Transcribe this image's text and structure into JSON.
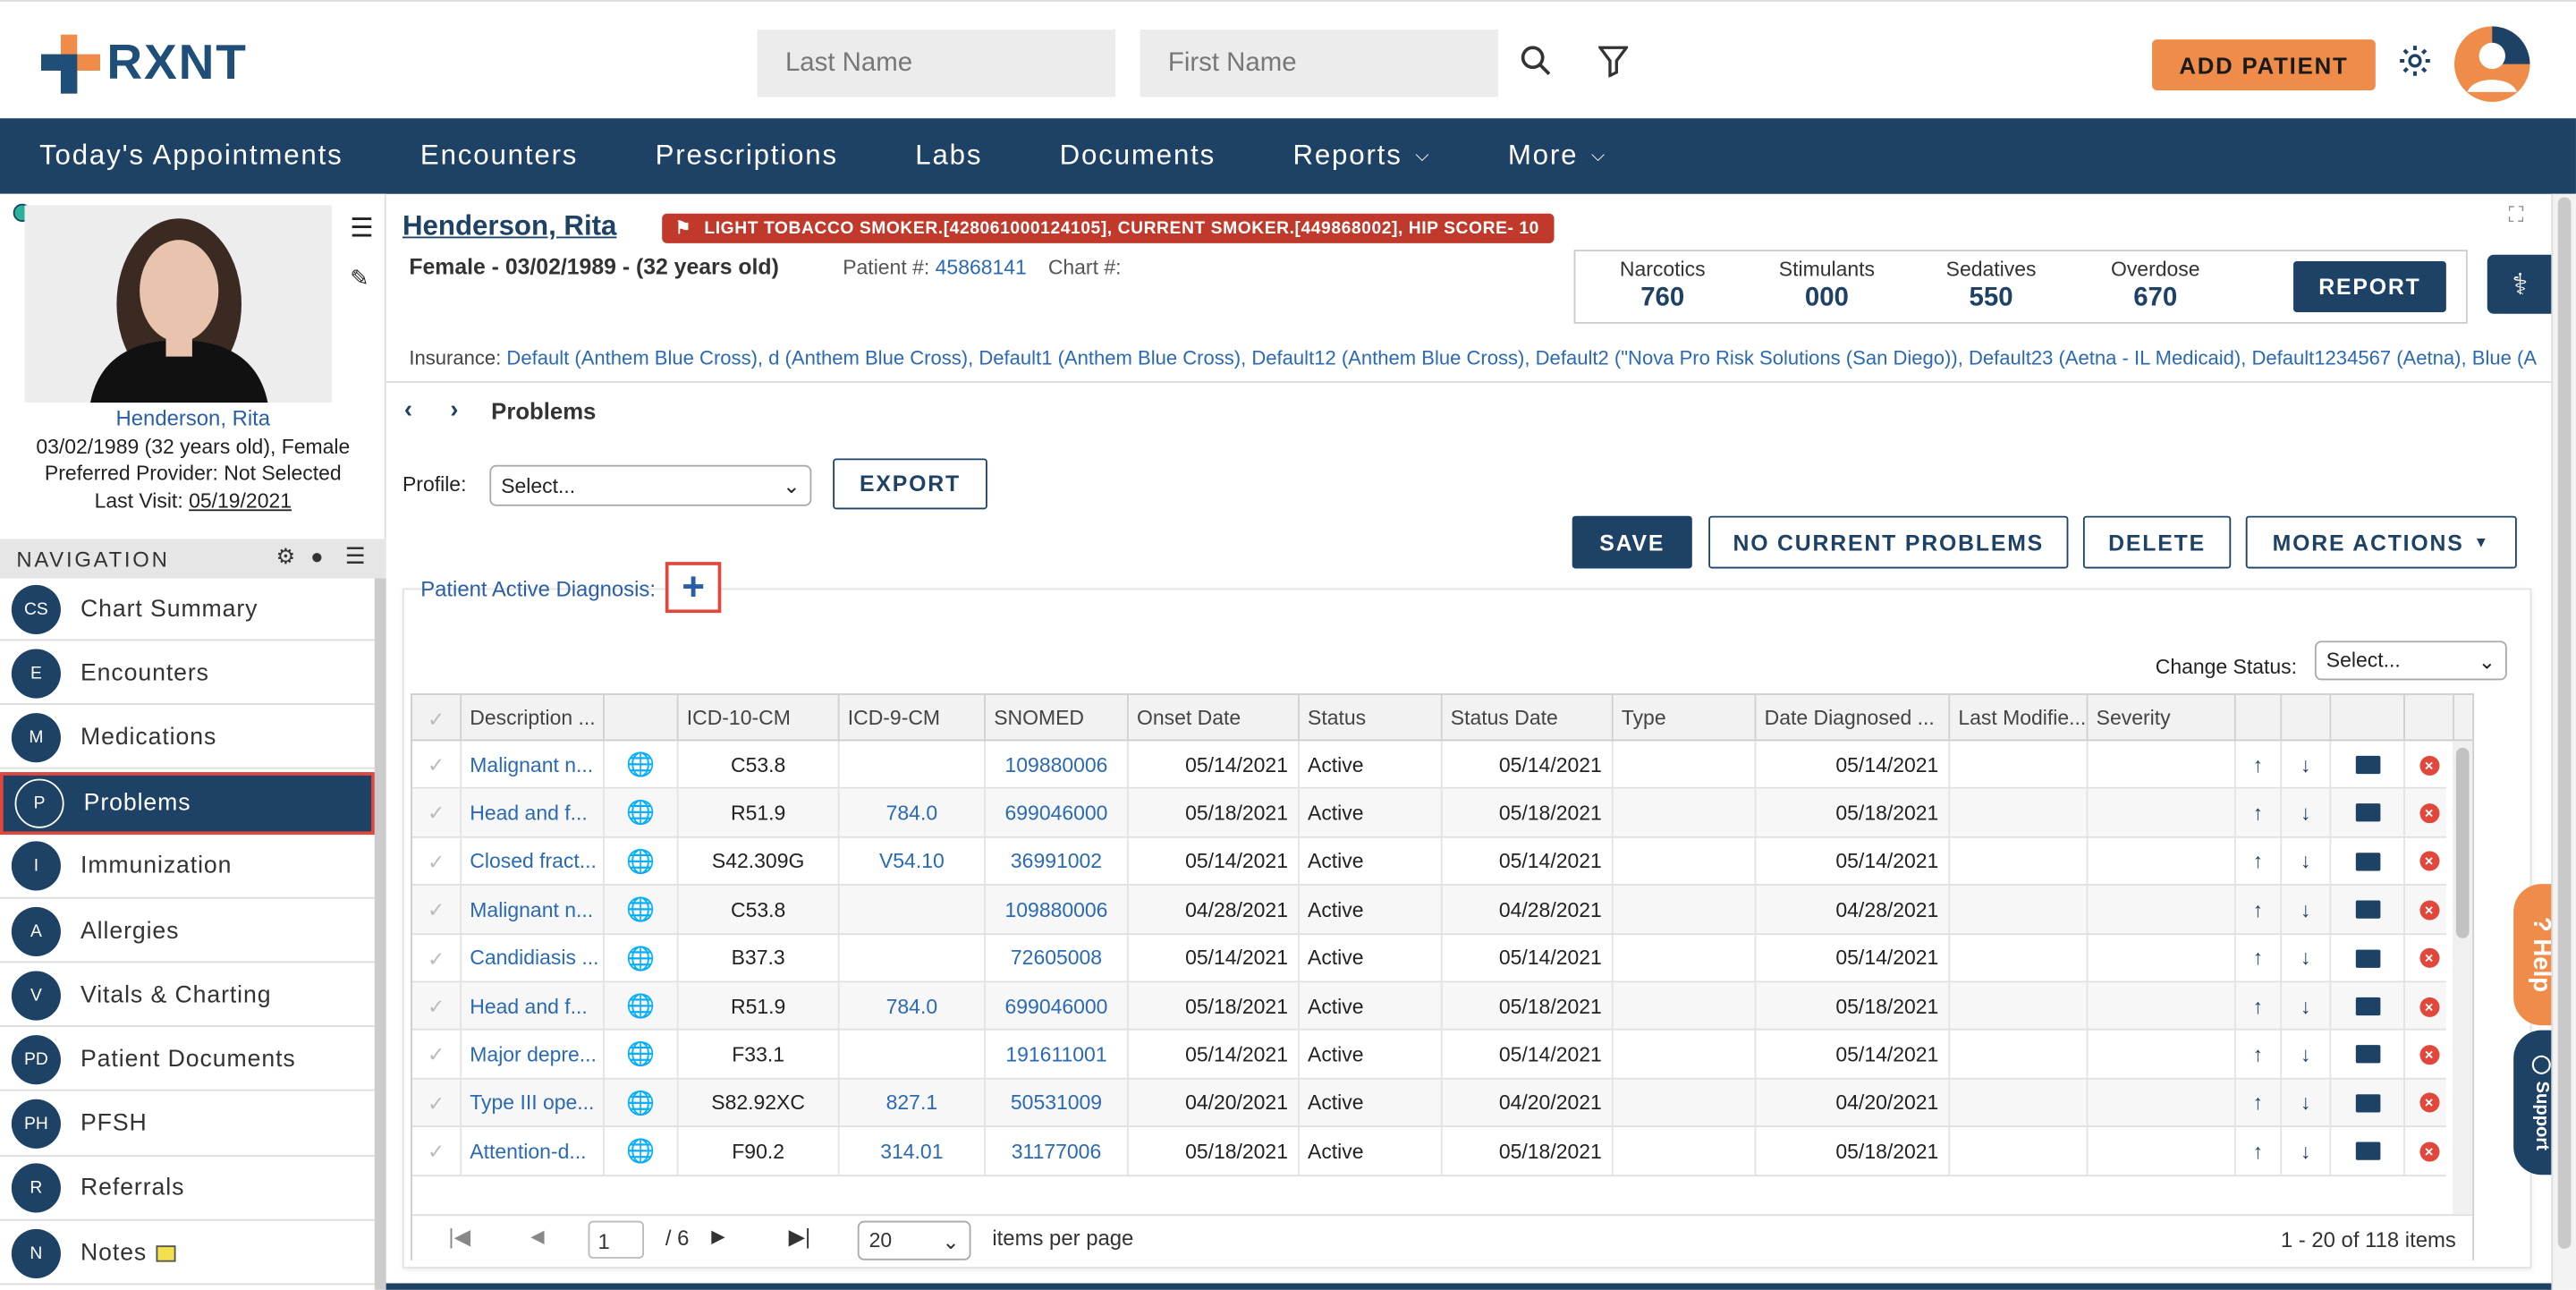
{
  "app": {
    "logo_text": "RXNT",
    "brand_color": "#1e4266",
    "accent_color": "#f08c4a"
  },
  "search": {
    "last_name_placeholder": "Last Name",
    "first_name_placeholder": "First Name"
  },
  "header": {
    "add_patient": "ADD PATIENT"
  },
  "nav": [
    "Today's Appointments",
    "Encounters",
    "Prescriptions",
    "Labs",
    "Documents",
    "Reports",
    "More"
  ],
  "patient": {
    "name": "Henderson, Rita",
    "flag": "LIGHT TOBACCO SMOKER.[428061000124105], CURRENT SMOKER.[449868002], HIP SCORE- 10",
    "demographics": "Female - 03/02/1989 - (32 years old)",
    "patient_num_label": "Patient #:",
    "patient_num": "45868141",
    "chart_num_label": "Chart #:",
    "insurance_label": "Insurance:",
    "insurance": "Default (Anthem Blue Cross), d (Anthem Blue Cross), Default1 (Anthem Blue Cross), Default12 (Anthem Blue Cross), Default2 (\"Nova Pro Risk Solutions (San Diego)), Default23 (Aetna - IL Medicaid), Default1234567 (Aetna), Blue (A",
    "left_name": "Henderson, Rita",
    "left_dob": "03/02/1989 (32 years old), Female",
    "left_provider": "Preferred Provider: Not Selected",
    "left_visit_label": "Last Visit:",
    "left_visit": "05/19/2021"
  },
  "stats": [
    {
      "label": "Narcotics",
      "value": "760"
    },
    {
      "label": "Stimulants",
      "value": "000"
    },
    {
      "label": "Sedatives",
      "value": "550"
    },
    {
      "label": "Overdose",
      "value": "670"
    }
  ],
  "report_btn": "REPORT",
  "left_nav": {
    "header": "NAVIGATION",
    "items": [
      {
        "abbr": "CS",
        "label": "Chart Summary"
      },
      {
        "abbr": "E",
        "label": "Encounters"
      },
      {
        "abbr": "M",
        "label": "Medications"
      },
      {
        "abbr": "P",
        "label": "Problems"
      },
      {
        "abbr": "I",
        "label": "Immunization"
      },
      {
        "abbr": "A",
        "label": "Allergies"
      },
      {
        "abbr": "V",
        "label": "Vitals & Charting"
      },
      {
        "abbr": "PD",
        "label": "Patient Documents"
      },
      {
        "abbr": "PH",
        "label": "PFSH"
      },
      {
        "abbr": "R",
        "label": "Referrals"
      },
      {
        "abbr": "N",
        "label": "Notes"
      }
    ]
  },
  "page": {
    "breadcrumb": "Problems",
    "profile_label": "Profile:",
    "profile_value": "Select...",
    "export": "EXPORT",
    "save": "SAVE",
    "no_current": "NO CURRENT PROBLEMS",
    "delete": "DELETE",
    "more_actions": "MORE ACTIONS",
    "active_dx": "Patient Active Diagnosis:",
    "change_status_label": "Change Status:",
    "change_status_value": "Select..."
  },
  "table": {
    "columns": [
      "Description ...",
      "",
      "ICD-10-CM",
      "ICD-9-CM",
      "SNOMED",
      "Onset Date",
      "Status",
      "Status Date",
      "Type",
      "Date Diagnosed ...",
      "Last Modifie...",
      "Severity"
    ],
    "rows": [
      [
        "Malignant n...",
        "C53.8",
        "",
        "109880006",
        "05/14/2021",
        "Active",
        "05/14/2021",
        "",
        "05/14/2021"
      ],
      [
        "Head and f...",
        "R51.9",
        "784.0",
        "699046000",
        "05/18/2021",
        "Active",
        "05/18/2021",
        "",
        "05/18/2021"
      ],
      [
        "Closed fract...",
        "S42.309G",
        "V54.10",
        "36991002",
        "05/14/2021",
        "Active",
        "05/14/2021",
        "",
        "05/14/2021"
      ],
      [
        "Malignant n...",
        "C53.8",
        "",
        "109880006",
        "04/28/2021",
        "Active",
        "04/28/2021",
        "",
        "04/28/2021"
      ],
      [
        "Candidiasis ...",
        "B37.3",
        "",
        "72605008",
        "05/14/2021",
        "Active",
        "05/14/2021",
        "",
        "05/14/2021"
      ],
      [
        "Head and f...",
        "R51.9",
        "784.0",
        "699046000",
        "05/18/2021",
        "Active",
        "05/18/2021",
        "",
        "05/18/2021"
      ],
      [
        "Major depre...",
        "F33.1",
        "",
        "191611001",
        "05/14/2021",
        "Active",
        "05/14/2021",
        "",
        "05/14/2021"
      ],
      [
        "Type III ope...",
        "S82.92XC",
        "827.1",
        "50531009",
        "04/20/2021",
        "Active",
        "04/20/2021",
        "",
        "04/20/2021"
      ],
      [
        "Attention-d...",
        "F90.2",
        "314.01",
        "31177006",
        "05/18/2021",
        "Active",
        "05/18/2021",
        "",
        "05/18/2021"
      ]
    ]
  },
  "pager": {
    "page": "1",
    "total_pages": "/ 6",
    "page_size": "20",
    "items_per_page": "items per page",
    "summary": "1 - 20 of 118 items"
  },
  "help": "? Help",
  "support": "Support"
}
